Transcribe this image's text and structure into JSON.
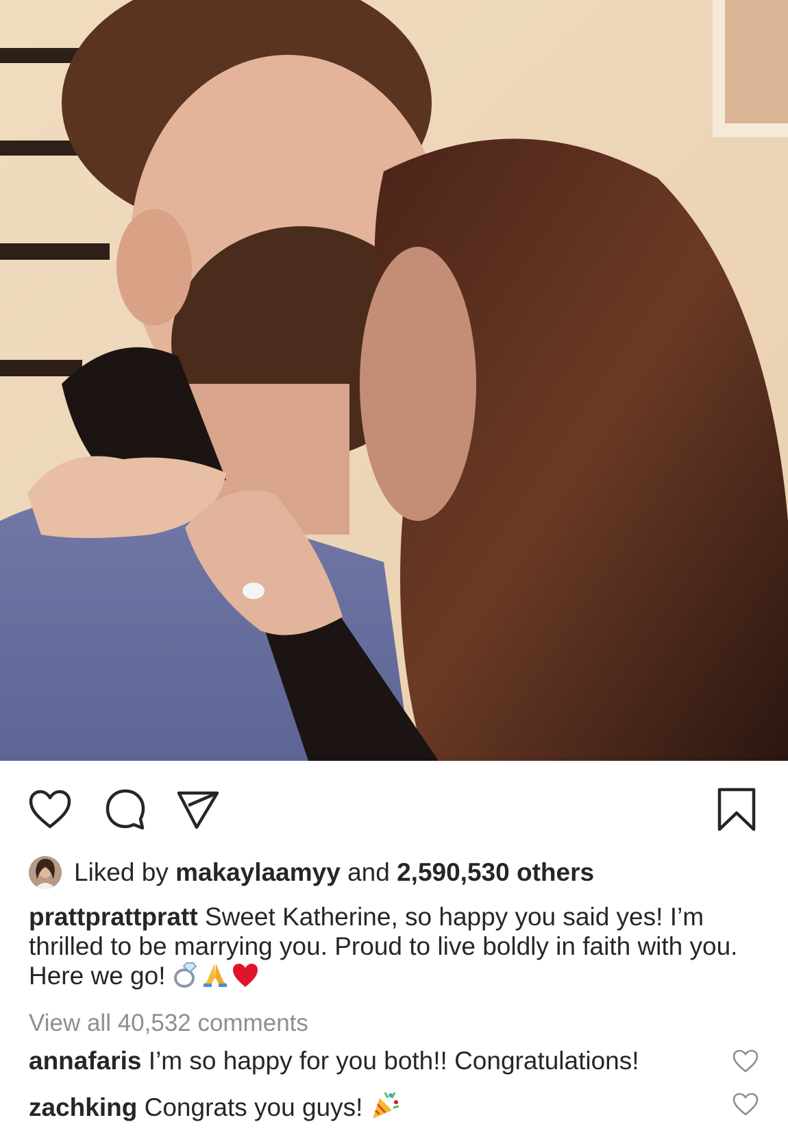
{
  "post": {
    "likes": {
      "prefix": "Liked by",
      "user": "makaylaamyy",
      "conjunction": "and",
      "count_text": "2,590,530 others"
    },
    "caption": {
      "username": "prattprattpratt",
      "text": "Sweet Katherine, so happy you said yes! I’m thrilled to be marrying you. Proud to live boldly in faith with you. Here we go!"
    },
    "view_all_comments": "View all 40,532 comments",
    "comments": [
      {
        "username": "annafaris",
        "text": "I’m so happy for you both!! Congratulations!"
      },
      {
        "username": "zachking",
        "text": "Congrats you guys!"
      }
    ]
  },
  "icons": {
    "like": "heart-icon",
    "comment": "speech-bubble-icon",
    "share": "paper-plane-icon",
    "save": "bookmark-icon",
    "caption_emojis": [
      "ring-emoji",
      "folded-hands-emoji",
      "red-heart-emoji"
    ],
    "comment_emoji": "party-popper-emoji"
  },
  "colors": {
    "text": "#262626",
    "muted": "#8e8e8e",
    "heart_red": "#e0152b"
  }
}
